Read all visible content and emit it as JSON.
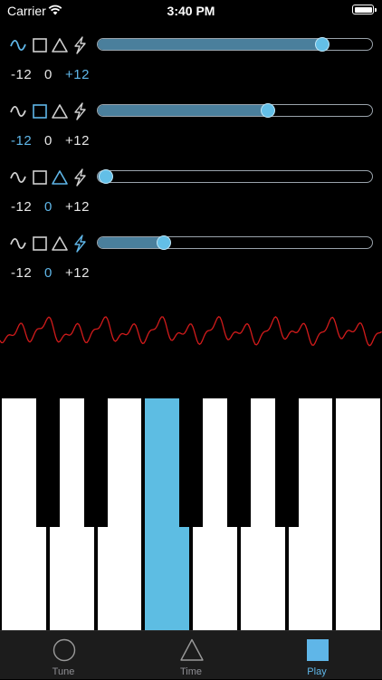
{
  "status_bar": {
    "carrier": "Carrier",
    "time": "3:40 PM"
  },
  "colors": {
    "accent": "#5fb6e8",
    "inactive": "#d0d0d0",
    "slider_fill": "#4a7f9c",
    "waveform": "#d21b1b",
    "active_key": "#5dbde3"
  },
  "oscillators": [
    {
      "active_wave": "sine",
      "level": 0.82,
      "octaves": [
        "-12",
        "0",
        "+12"
      ],
      "active_octave": 2
    },
    {
      "active_wave": "square",
      "level": 0.62,
      "octaves": [
        "-12",
        "0",
        "+12"
      ],
      "active_octave": 0
    },
    {
      "active_wave": "triangle",
      "level": 0.03,
      "octaves": [
        "-12",
        "0",
        "+12"
      ],
      "active_octave": 1
    },
    {
      "active_wave": "sawtooth",
      "level": 0.24,
      "octaves": [
        "-12",
        "0",
        "+12"
      ],
      "active_octave": 1
    }
  ],
  "wave_icons": [
    "sine-wave-icon",
    "square-wave-icon",
    "triangle-wave-icon",
    "lightning-icon"
  ],
  "keyboard": {
    "white_keys": 8,
    "active_white_key": 3,
    "black_keys_after_white": [
      0,
      1,
      3,
      4,
      5
    ]
  },
  "tabs": [
    {
      "label": "Tune",
      "icon": "circle-icon",
      "active": false
    },
    {
      "label": "Time",
      "icon": "triangle-icon",
      "active": false
    },
    {
      "label": "Play",
      "icon": "square-icon",
      "active": true
    }
  ]
}
